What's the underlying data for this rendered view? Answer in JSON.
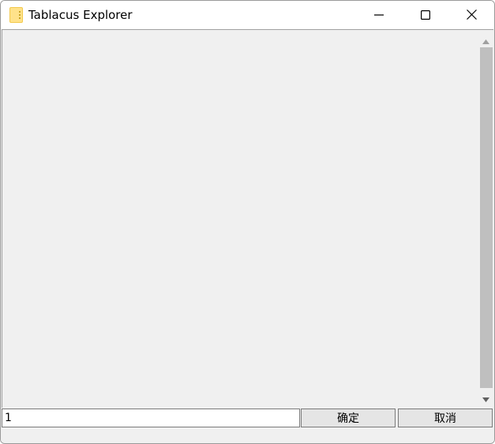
{
  "window": {
    "title": "Tablacus Explorer"
  },
  "titlebar_buttons": {
    "minimize_icon": "minimize-icon",
    "maximize_icon": "maximize-icon",
    "close_icon": "close-icon"
  },
  "input": {
    "value": "1"
  },
  "buttons": {
    "ok_label": "确定",
    "cancel_label": "取消"
  },
  "colors": {
    "titlebar": "#ffffff",
    "body": "#f0f0f0",
    "scroll_thumb": "#bfbfbf",
    "folder_icon": "#ffe28a"
  }
}
